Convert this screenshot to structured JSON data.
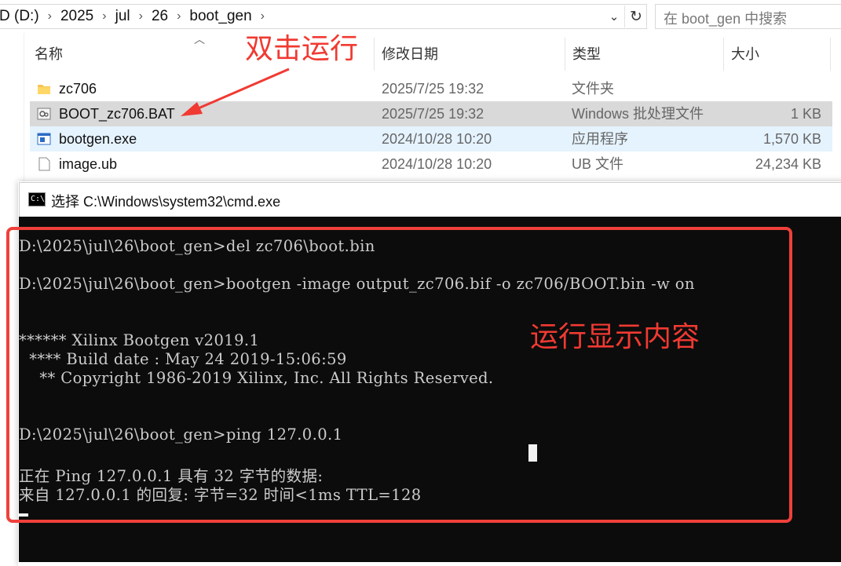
{
  "address_bar": {
    "crumbs": [
      "D (D:)",
      "2025",
      "jul",
      "26",
      "boot_gen"
    ],
    "search_placeholder": "在 boot_gen 中搜索"
  },
  "file_list": {
    "columns": {
      "name": "名称",
      "date": "修改日期",
      "type": "类型",
      "size": "大小"
    },
    "rows": [
      {
        "name": "zc706",
        "date": "2025/7/25 19:32",
        "type": "文件夹",
        "size": "",
        "icon": "folder-icon"
      },
      {
        "name": "BOOT_zc706.BAT",
        "date": "2025/7/25 19:32",
        "type": "Windows 批处理文件",
        "size": "1 KB",
        "icon": "batch-file-icon"
      },
      {
        "name": "bootgen.exe",
        "date": "2024/10/28 10:20",
        "type": "应用程序",
        "size": "1,570 KB",
        "icon": "exe-file-icon"
      },
      {
        "name": "image.ub",
        "date": "2024/10/28 10:20",
        "type": "UB 文件",
        "size": "24,234 KB",
        "icon": "generic-file-icon"
      }
    ]
  },
  "annotations": {
    "double_click": "双击运行",
    "output_label": "运行显示内容",
    "color": "#f03a32"
  },
  "cmd": {
    "title": "选择 C:\\Windows\\system32\\cmd.exe",
    "lines": [
      "D:\\2025\\jul\\26\\boot_gen>del zc706\\boot.bin",
      "D:\\2025\\jul\\26\\boot_gen>bootgen -image output_zc706.bif -o zc706/BOOT.bin -w on",
      "****** Xilinx Bootgen v2019.1",
      "  **** Build date : May 24 2019-15:06:59",
      "    ** Copyright 1986-2019 Xilinx, Inc. All Rights Reserved.",
      "D:\\2025\\jul\\26\\boot_gen>ping 127.0.0.1",
      "正在 Ping 127.0.0.1 具有 32 字节的数据:",
      "来自 127.0.0.1 的回复: 字节=32 时间<1ms TTL=128"
    ]
  }
}
